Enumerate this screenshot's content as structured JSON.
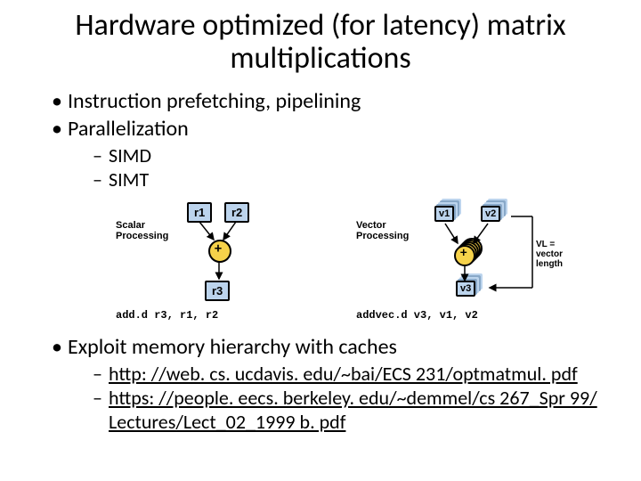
{
  "title": "Hardware optimized (for latency) matrix multiplications",
  "bullets": {
    "b1": "Instruction prefetching, pipelining",
    "b2": "Parallelization",
    "b2a": "SIMD",
    "b2b": "SIMT",
    "b3": "Exploit memory hierarchy with caches",
    "b3a": "http: //web. cs. ucdavis. edu/~bai/ECS 231/optmatmul. pdf",
    "b3b": "https: //people. eecs. berkeley. edu/~demmel/cs 267_Spr 99/ Lectures/Lect_02_1999 b. pdf"
  },
  "fig": {
    "scalar": {
      "label": "Scalar Processing",
      "r1": "r1",
      "r2": "r2",
      "r3": "r3",
      "instr": "add.d r3, r1, r2"
    },
    "vector": {
      "label": "Vector Processing",
      "v1": "v1",
      "v2": "v2",
      "v3": "v3",
      "vlnote": "VL = vector length",
      "instr": "addvec.d v3, v1, v2"
    }
  }
}
